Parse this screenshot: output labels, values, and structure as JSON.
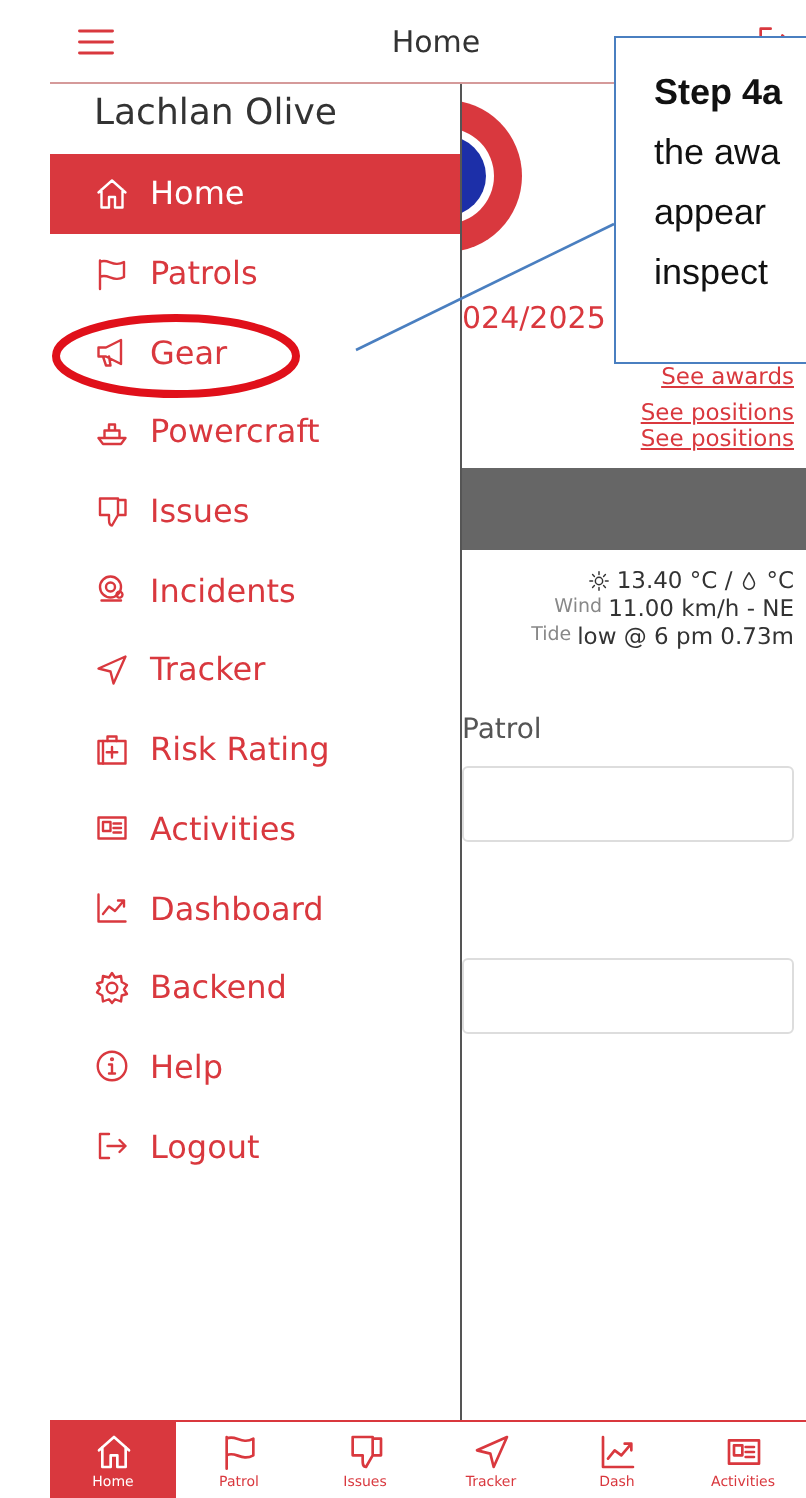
{
  "header": {
    "title": "Home"
  },
  "drawer": {
    "user_name": "Lachlan Olive",
    "items": [
      {
        "label": "Home",
        "selected": true
      },
      {
        "label": "Patrols",
        "selected": false
      },
      {
        "label": "Gear",
        "selected": false
      },
      {
        "label": "Powercraft",
        "selected": false
      },
      {
        "label": "Issues",
        "selected": false
      },
      {
        "label": "Incidents",
        "selected": false
      },
      {
        "label": "Tracker",
        "selected": false
      },
      {
        "label": "Risk Rating",
        "selected": false
      },
      {
        "label": "Activities",
        "selected": false
      },
      {
        "label": "Dashboard",
        "selected": false
      },
      {
        "label": "Backend",
        "selected": false
      },
      {
        "label": "Help",
        "selected": false
      },
      {
        "label": "Logout",
        "selected": false
      }
    ]
  },
  "content": {
    "season": "024/2025",
    "awards_link": "See awards",
    "positions_links": [
      "See positions",
      "See positions"
    ],
    "weather": {
      "temperature": "13.40 °C /",
      "humidity_unit": "°C",
      "wind_label": "Wind",
      "wind": "11.00 km/h - NE",
      "tide_label": "Tide",
      "tide": "low @ 6 pm 0.73m"
    },
    "patrol_label": "Patrol"
  },
  "callout": {
    "heading": "Step 4a",
    "lines": [
      "the awa",
      "appear",
      "inspect"
    ]
  },
  "tab_bar": [
    {
      "label": "Home",
      "selected": true
    },
    {
      "label": "Patrol",
      "selected": false
    },
    {
      "label": "Issues",
      "selected": false
    },
    {
      "label": "Tracker",
      "selected": false
    },
    {
      "label": "Dash",
      "selected": false
    },
    {
      "label": "Activities",
      "selected": false
    }
  ]
}
